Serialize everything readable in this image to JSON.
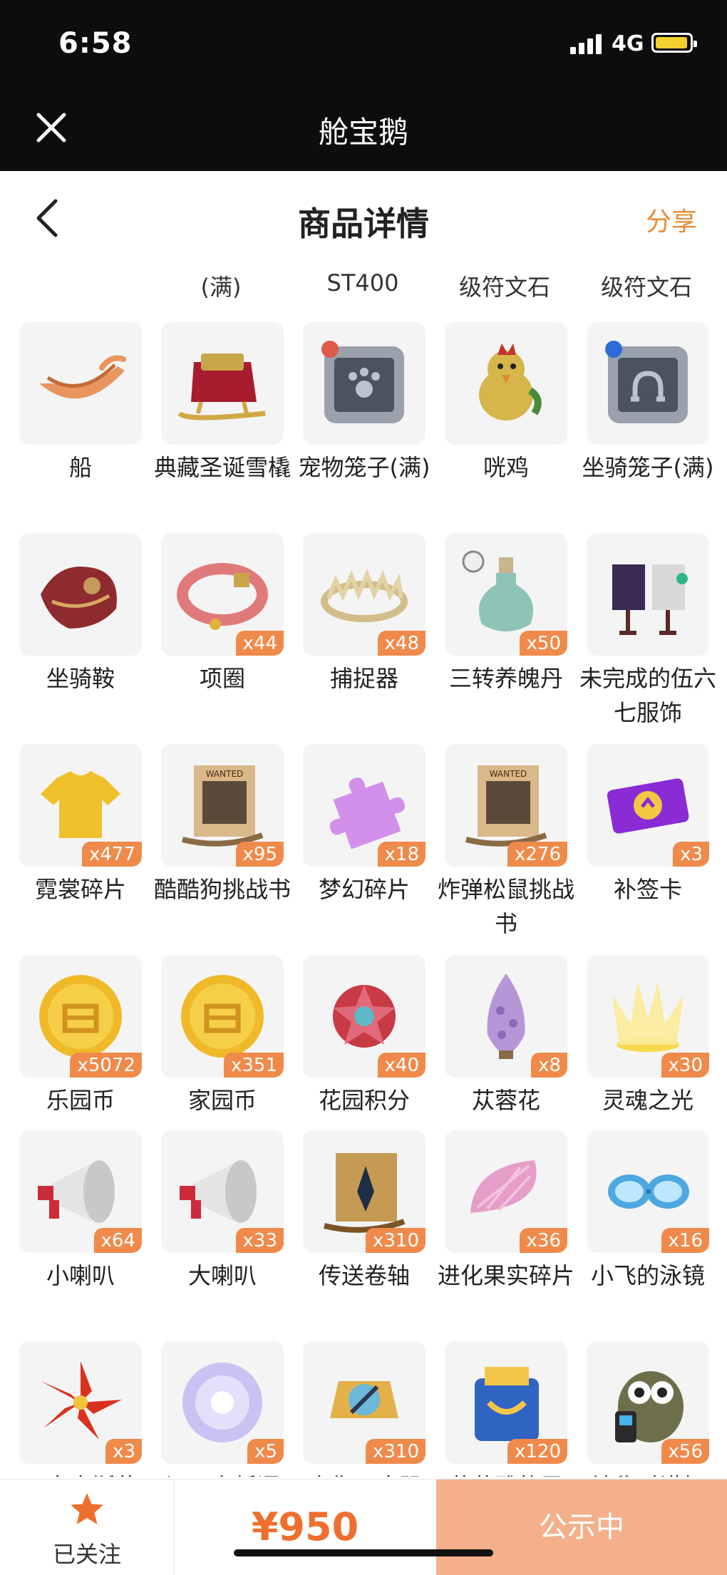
{
  "status": {
    "time": "6:58",
    "network": "4G"
  },
  "app": {
    "title": "舱宝鹅"
  },
  "header": {
    "title": "商品详情",
    "share": "分享"
  },
  "partial_row": [
    "(满)",
    "ST400",
    "级符文石",
    "级符文石"
  ],
  "items": [
    {
      "name": "船",
      "qty": "",
      "icon": "boat-icon"
    },
    {
      "name": "典藏圣诞雪橇",
      "qty": "",
      "icon": "sleigh-icon"
    },
    {
      "name": "宠物笼子(满)",
      "qty": "",
      "icon": "pet-cage-icon"
    },
    {
      "name": "咣鸡",
      "qty": "",
      "icon": "chicken-icon"
    },
    {
      "name": "坐骑笼子(满)",
      "qty": "",
      "icon": "mount-cage-icon"
    },
    {
      "name": "坐骑鞍",
      "qty": "",
      "icon": "saddle-icon"
    },
    {
      "name": "项圈",
      "qty": "x44",
      "icon": "collar-icon"
    },
    {
      "name": "捕捉器",
      "qty": "x48",
      "icon": "trap-icon"
    },
    {
      "name": "三转养魄丹",
      "qty": "x50",
      "icon": "potion-icon"
    },
    {
      "name": "未完成的伍六七服饰",
      "qty": "",
      "icon": "costume-icon"
    },
    {
      "name": "霓裳碎片",
      "qty": "x477",
      "icon": "shirt-icon"
    },
    {
      "name": "酷酷狗挑战书",
      "qty": "x95",
      "icon": "wanted-scroll-icon"
    },
    {
      "name": "梦幻碎片",
      "qty": "x18",
      "icon": "puzzle-icon"
    },
    {
      "name": "炸弹松鼠挑战书",
      "qty": "x276",
      "icon": "wanted-scroll-icon"
    },
    {
      "name": "补签卡",
      "qty": "x3",
      "icon": "ticket-icon"
    },
    {
      "name": "乐园币",
      "qty": "x5072",
      "icon": "coin-icon"
    },
    {
      "name": "家园币",
      "qty": "x351",
      "icon": "coin-icon"
    },
    {
      "name": "花园积分",
      "qty": "x40",
      "icon": "flower-badge-icon"
    },
    {
      "name": "苁蓉花",
      "qty": "x8",
      "icon": "cistanche-icon"
    },
    {
      "name": "灵魂之光",
      "qty": "x30",
      "icon": "soul-light-icon"
    },
    {
      "name": "小喇叭",
      "qty": "x64",
      "icon": "megaphone-icon"
    },
    {
      "name": "大喇叭",
      "qty": "x33",
      "icon": "megaphone-icon"
    },
    {
      "name": "传送卷轴",
      "qty": "x310",
      "icon": "scroll-icon"
    },
    {
      "name": "进化果实碎片",
      "qty": "x36",
      "icon": "fruit-slice-icon"
    },
    {
      "name": "小飞的泳镜",
      "qty": "x16",
      "icon": "goggles-icon"
    },
    {
      "name": "圣自奋斯花",
      "qty": "x3",
      "icon": "red-flower-icon"
    },
    {
      "name": "旧日之纸语",
      "qty": "x5",
      "icon": "orb-icon"
    },
    {
      "name": "魔像召唤器",
      "qty": "x310",
      "icon": "summoner-icon"
    },
    {
      "name": "菲菲雅的露",
      "qty": "x120",
      "icon": "pack-icon"
    },
    {
      "name": "神秘对讲机",
      "qty": "x56",
      "icon": "walkie-owl-icon"
    }
  ],
  "bottom": {
    "follow": "已关注",
    "price": "¥950",
    "status": "公示中"
  },
  "colors": {
    "accent": "#ee6f2d",
    "badge": "#f08a4b",
    "cta": "#f3b08a"
  }
}
